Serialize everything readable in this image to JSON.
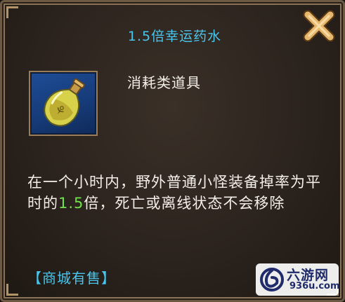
{
  "dialog": {
    "title": "1.5倍幸运药水",
    "category": "消耗类道具",
    "description": {
      "part1": "在一个小时内，野外普通小怪装备掉率为平时的",
      "highlight": "1.5",
      "part2": "倍，死亡或离线状态不会移除"
    },
    "shop_link": "【商城有售】",
    "close_icon": "close-x-icon",
    "item_icon": "potion-bottle-icon"
  },
  "watermark": {
    "name": "六游网",
    "domain": "936u.com"
  },
  "colors": {
    "title": "#49c6ee",
    "highlight": "#6fe34a",
    "text": "#f3efe8",
    "close": "#e8b76e",
    "frame": "#9a7d57"
  }
}
